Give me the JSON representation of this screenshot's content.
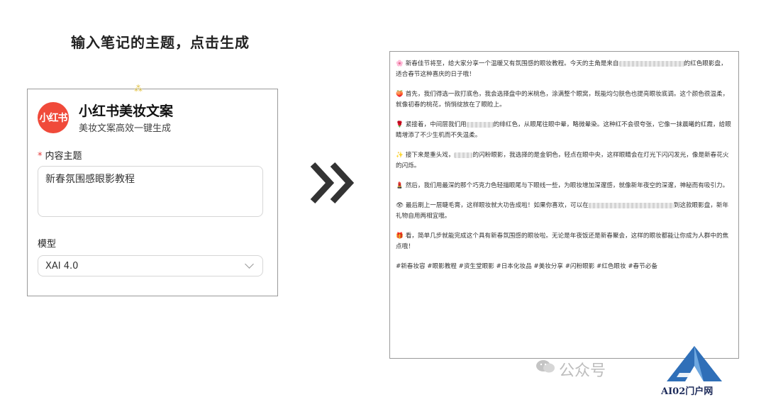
{
  "heading": "输入笔记的主题，点击生成",
  "form": {
    "logo_text": "小红书",
    "title": "小红书美妆文案",
    "subtitle": "美妆文案高效一键生成",
    "topic_label": "内容主题",
    "topic_required_mark": "*",
    "topic_value": "新春氛围感眼影教程",
    "model_label": "模型",
    "model_value": "XAI 4.0"
  },
  "output": {
    "paragraphs": [
      {
        "icon": "🌸",
        "before": "新春佳节将至，给大家分享一个温暖又有氛围感的眼妆教程。今天的主角是来自",
        "after": "的红色眼影盘，适合春节这种喜庆的日子哦！"
      },
      {
        "icon": "🍑",
        "before": "首先，我们得选一款打底色，我会选择盘中的米桃色，涂满整个眼窝，既能均匀肤色也提亮眼妆底调。这个颜色很温柔，就像初春的桃花，悄悄绽放在了眼睑上。",
        "after": ""
      },
      {
        "icon": "🌹",
        "before": "紧接着，中间层我们用",
        "after": "的绯红色，从眼尾往眼中晕，略微晕染。这种红不会很夸张，它像一抹晨曦的红霞，给眼睛增添了不少生机而不失温柔。"
      },
      {
        "icon": "✨",
        "before": "接下来是重头戏，",
        "after": "的闪粉眼影，我选择的是金铜色，轻点在眼中央，这样眼睛会在灯光下闪闪发光，像是新春花火的闪烁。"
      },
      {
        "icon": "💄",
        "before": "然后，我们用最深的那个巧克力色轻描眼尾与下眼线一些，为眼妆增加深邃感，就像新年夜空的深邃，神秘而有吸引力。",
        "after": ""
      },
      {
        "icon": "👁",
        "before": "最后刷上一层睫毛膏，这样眼妆就大功告成啦！如果你喜欢，可以在",
        "after": "到这款眼影盘，新年礼物自用两相宜哦。"
      },
      {
        "icon": "🎁",
        "before": "看，简单几步就能完成这个具有新春氛围感的眼妆啦。无论是年夜饭还是新春聚会，这样的眼妆都能让你成为人群中的焦点哦！",
        "after": ""
      }
    ],
    "tags": "#新春妆容 #眼影教程 #资生堂眼影 #日本化妆品 #美妆分享 #闪粉眼影 #红色眼妆 #春节必备"
  },
  "watermark": {
    "text": "公众号"
  },
  "brand": {
    "text": "AI02门户网"
  },
  "colors": {
    "logo_bg": "#f04a3a",
    "required": "#e23b3b",
    "brand": "#2f6fb8"
  }
}
